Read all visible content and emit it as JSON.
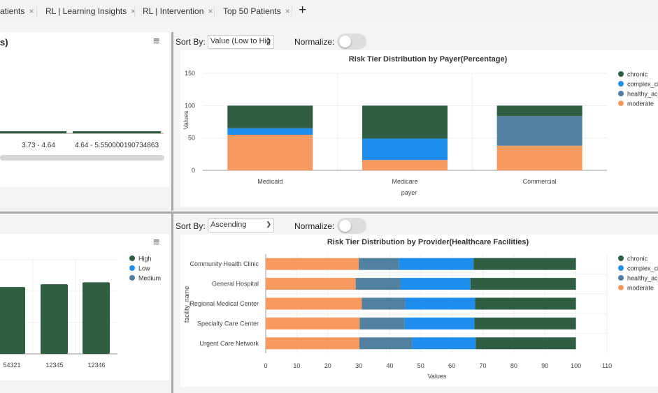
{
  "tabs": [
    {
      "label": "atients"
    },
    {
      "label": "RL | Learning Insights"
    },
    {
      "label": "RL | Intervention"
    },
    {
      "label": "Top 50 Patients"
    }
  ],
  "tab_close": "×",
  "add_tab": "+",
  "top_left": {
    "title_fragment": "s)",
    "menu_icon": "≡",
    "chart_data": {
      "type": "bar",
      "categories": [
        "3.73 - 4.64",
        "4.64 - 5.550000190734863"
      ],
      "values": [
        1,
        1
      ],
      "note": "values relative; axis not visible"
    }
  },
  "top_right": {
    "sort_label": "Sort By:",
    "sort_value": "Value (Low to Hig",
    "normalize_label": "Normalize:",
    "normalize_on": false
  },
  "bottom_right": {
    "sort_label": "Sort By:",
    "sort_value": "Ascending",
    "normalize_label": "Normalize:",
    "normalize_on": false
  },
  "bottom_left": {
    "menu_icon": "≡",
    "chart_data": {
      "type": "bar",
      "categories": [
        "54321",
        "12345",
        "12346"
      ],
      "series": [
        {
          "name": "High",
          "values": [
            0.71,
            0.74,
            0.76
          ]
        }
      ],
      "legend": [
        "High",
        "Low",
        "Medium"
      ],
      "note": "values as fraction of plot height; axis not visible"
    }
  },
  "colors": {
    "chronic": "#2f5e42",
    "complex_ch": "#1f8ded",
    "healthy_acu": "#52809f",
    "moderate": "#f89a5f",
    "High": "#2f5e42",
    "Low": "#1f8ded",
    "Medium": "#52809f"
  },
  "chart_data": [
    {
      "type": "bar",
      "stacked": true,
      "title": "Risk Tier Distribution by Payer(Percentage)",
      "xlabel": "payer",
      "ylabel": "Values",
      "ylim": [
        0,
        150
      ],
      "yticks": [
        "0",
        "50",
        "100",
        "150"
      ],
      "categories": [
        "Medicaid",
        "Medicare",
        "Commercial"
      ],
      "series": [
        {
          "name": "moderate",
          "values": [
            55,
            16,
            38
          ]
        },
        {
          "name": "healthy_acu",
          "values": [
            0,
            0,
            46
          ]
        },
        {
          "name": "complex_ch",
          "values": [
            10,
            33,
            0
          ]
        },
        {
          "name": "chronic",
          "values": [
            35,
            51,
            16
          ]
        }
      ],
      "legend": [
        "chronic",
        "complex_ch",
        "healthy_acu",
        "moderate"
      ],
      "legend_position": "right"
    },
    {
      "type": "bar",
      "stacked": true,
      "orientation": "horizontal",
      "title": "Risk Tier Distribution by Provider(Healthcare Facilities)",
      "xlabel": "Values",
      "ylabel": "facility_name",
      "xlim": [
        0,
        110
      ],
      "xticks": [
        "0",
        "10",
        "20",
        "30",
        "40",
        "50",
        "60",
        "70",
        "80",
        "90",
        "100",
        "110"
      ],
      "categories": [
        "Community Health Clinic",
        "General Hospital",
        "Regional Medical Center",
        "Specialty Care Center",
        "Urgent Care Network"
      ],
      "series": [
        {
          "name": "moderate",
          "values": [
            30,
            29,
            31,
            30.3,
            30.2
          ]
        },
        {
          "name": "healthy_acu",
          "values": [
            13,
            14.5,
            14,
            14.5,
            17
          ]
        },
        {
          "name": "complex_ch",
          "values": [
            24,
            22.5,
            22.5,
            22.5,
            20.5
          ]
        },
        {
          "name": "chronic",
          "values": [
            33,
            34,
            32.5,
            32.7,
            32.3
          ]
        }
      ],
      "legend": [
        "chronic",
        "complex_ch",
        "healthy_acu",
        "moderate"
      ],
      "legend_position": "right"
    }
  ]
}
